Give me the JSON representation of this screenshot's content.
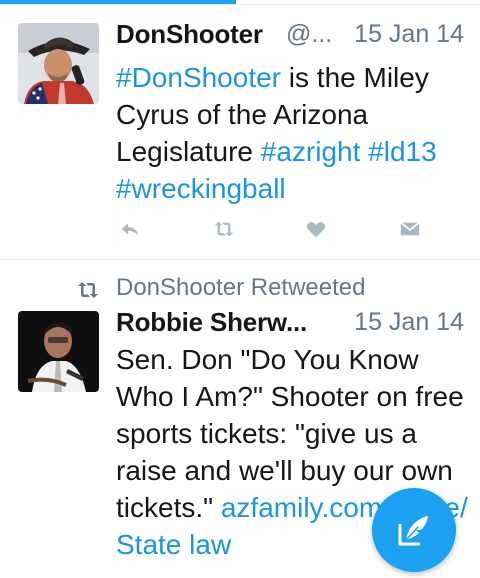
{
  "colors": {
    "accent": "#1da1f2",
    "link": "#1b95e0",
    "text": "#14171a",
    "muted": "#657786",
    "icon": "#aab8c2"
  },
  "tweets": [
    {
      "name": "DonShooter",
      "handle": "@...",
      "date": "15 Jan 14",
      "body": [
        {
          "text": "#DonShooter",
          "link": true
        },
        {
          "text": " is the Miley Cyrus of the Arizona Legislature ",
          "link": false
        },
        {
          "text": "#azright",
          "link": true
        },
        {
          "text": " ",
          "link": false
        },
        {
          "text": "#ld13",
          "link": true
        },
        {
          "text": " ",
          "link": false
        },
        {
          "text": "#wreckingball",
          "link": true
        }
      ],
      "actions": [
        "reply-icon",
        "retweet-icon",
        "like-icon",
        "direct-message-icon"
      ]
    },
    {
      "retweeted_by": "DonShooter Retweeted",
      "name": "Robbie Sherw...",
      "date": "15 Jan 14",
      "body": [
        {
          "text": "Sen. Don \"Do You Know Who I Am?\" Shooter on free sports tickets: \"give us a raise and we'll buy our own tickets.\" ",
          "link": false
        },
        {
          "text": "azfamily.com/home/",
          "link": true
        },
        {
          "text": " State law",
          "link": true
        }
      ]
    }
  ],
  "fab": {
    "icon": "compose-tweet-icon"
  }
}
